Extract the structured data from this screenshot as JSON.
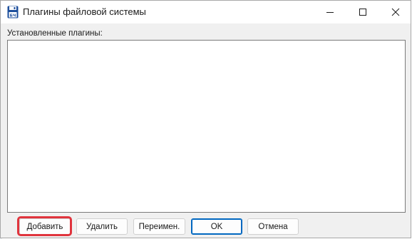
{
  "window": {
    "title": "Плагины файловой системы",
    "icon": "floppy-disk-icon",
    "controls": {
      "minimize": "minimize-icon",
      "maximize": "maximize-icon",
      "close": "close-icon"
    }
  },
  "content": {
    "list_label": "Установленные плагины:",
    "list_items": []
  },
  "buttons": {
    "add": "Добавить",
    "remove": "Удалить",
    "rename": "Переимен.",
    "ok": "OK",
    "cancel": "Отмена"
  },
  "highlight": {
    "target": "add-button",
    "color": "#e0343d"
  },
  "colors": {
    "dialog_bg": "#f0f0f0",
    "default_button_accent": "#0067c0",
    "icon_blue": "#1e4f9c"
  }
}
